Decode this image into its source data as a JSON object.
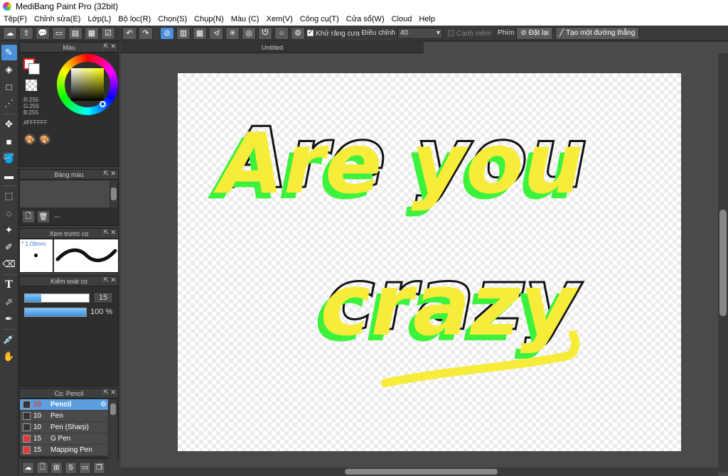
{
  "window": {
    "title": "MediBang Paint Pro (32bit)"
  },
  "menu": [
    "Tệp(F)",
    "Chỉnh sửa(E)",
    "Lớp(L)",
    "Bộ lọc(R)",
    "Chọn(S)",
    "Chụp(N)",
    "Màu (C)",
    "Xem(V)",
    "Công cụ(T)",
    "Cửa sổ(W)",
    "Cloud",
    "Help"
  ],
  "toolbar": {
    "antialias_label": "Khử răng cưa",
    "correction_label": "Điều chỉnh",
    "correction_value": "40",
    "soft_edge_label": "Cạnh mềm",
    "key_label": "Phím",
    "reset_label": "Đặt lại",
    "straight_line_label": "Tạo một đường thẳng"
  },
  "color_panel": {
    "title": "Màu",
    "r": "R:255",
    "g": "G:255",
    "b": "B:255",
    "hex": "#FFFFFF"
  },
  "palette_panel": {
    "title": "Bảng màu",
    "footer": "---"
  },
  "brush_preview": {
    "title": "Xem trước cọ",
    "size": "* 1.09mm"
  },
  "brush_control": {
    "title": "Kiểm soát cọ",
    "size": "15",
    "opacity": "100 %",
    "size_fraction": 0.25,
    "opacity_fraction": 1.0
  },
  "brush_list": {
    "title": "Cọ: Pencil",
    "items": [
      {
        "size": "15",
        "name": "Pencil",
        "color": "#333333",
        "selected": true
      },
      {
        "size": "10",
        "name": "Pen",
        "color": "#333333",
        "selected": false
      },
      {
        "size": "10",
        "name": "Pen (Sharp)",
        "color": "#333333",
        "selected": false
      },
      {
        "size": "15",
        "name": "G Pen",
        "color": "#e23b3b",
        "selected": false
      },
      {
        "size": "15",
        "name": "Mapping Pen",
        "color": "#e23b3b",
        "selected": false
      }
    ]
  },
  "document": {
    "tab_title": "Untitled",
    "text_line1": "Are you",
    "text_line2": "crazy",
    "colors": {
      "yellow": "#f7ec3a",
      "green": "#3cf23c",
      "outline": "#111111"
    }
  }
}
